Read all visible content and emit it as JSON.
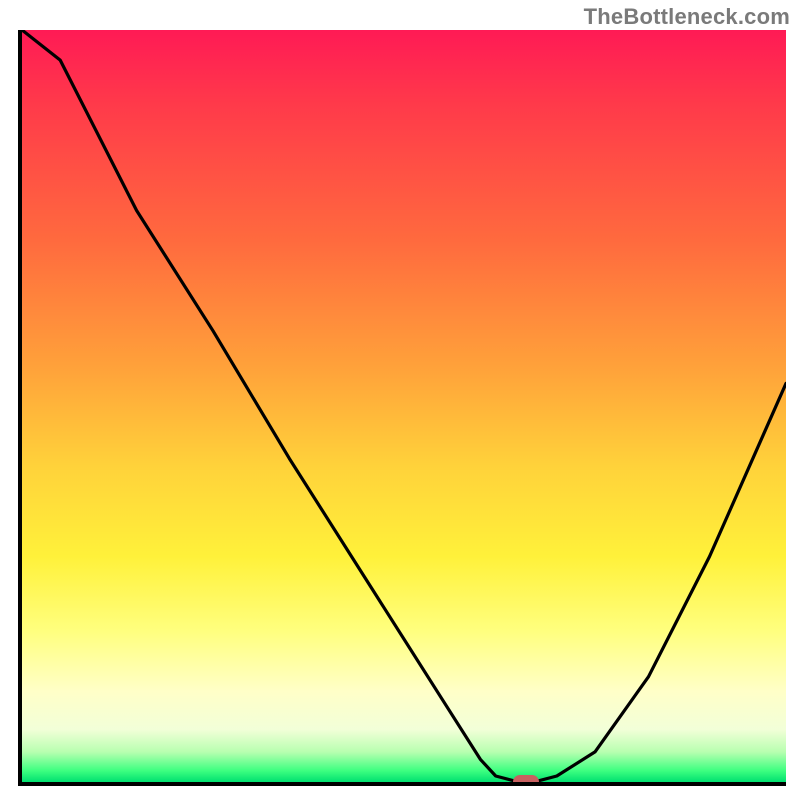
{
  "attribution": "TheBottleneck.com",
  "chart_data": {
    "type": "line",
    "title": "",
    "xlabel": "",
    "ylabel": "",
    "xlim": [
      0,
      100
    ],
    "ylim": [
      0,
      100
    ],
    "x": [
      0,
      5,
      15,
      25,
      35,
      45,
      55,
      60,
      62,
      65,
      67,
      70,
      75,
      82,
      90,
      100
    ],
    "values": [
      100,
      96,
      76,
      60,
      43,
      27,
      11,
      3,
      0.8,
      0,
      0,
      0.8,
      4,
      14,
      30,
      53
    ],
    "background_gradient": {
      "stops": [
        {
          "pct": 0,
          "color": "#ff1a55"
        },
        {
          "pct": 10,
          "color": "#ff3a4a"
        },
        {
          "pct": 28,
          "color": "#ff6a3e"
        },
        {
          "pct": 45,
          "color": "#ffa23a"
        },
        {
          "pct": 58,
          "color": "#ffd23a"
        },
        {
          "pct": 70,
          "color": "#fff13a"
        },
        {
          "pct": 80,
          "color": "#ffff7f"
        },
        {
          "pct": 88,
          "color": "#ffffc8"
        },
        {
          "pct": 93,
          "color": "#f2ffd8"
        },
        {
          "pct": 96,
          "color": "#b8ffb0"
        },
        {
          "pct": 98.5,
          "color": "#3dff80"
        },
        {
          "pct": 100,
          "color": "#00e070"
        }
      ]
    },
    "marker": {
      "x": 66,
      "y": 0,
      "color": "#c86060"
    }
  }
}
